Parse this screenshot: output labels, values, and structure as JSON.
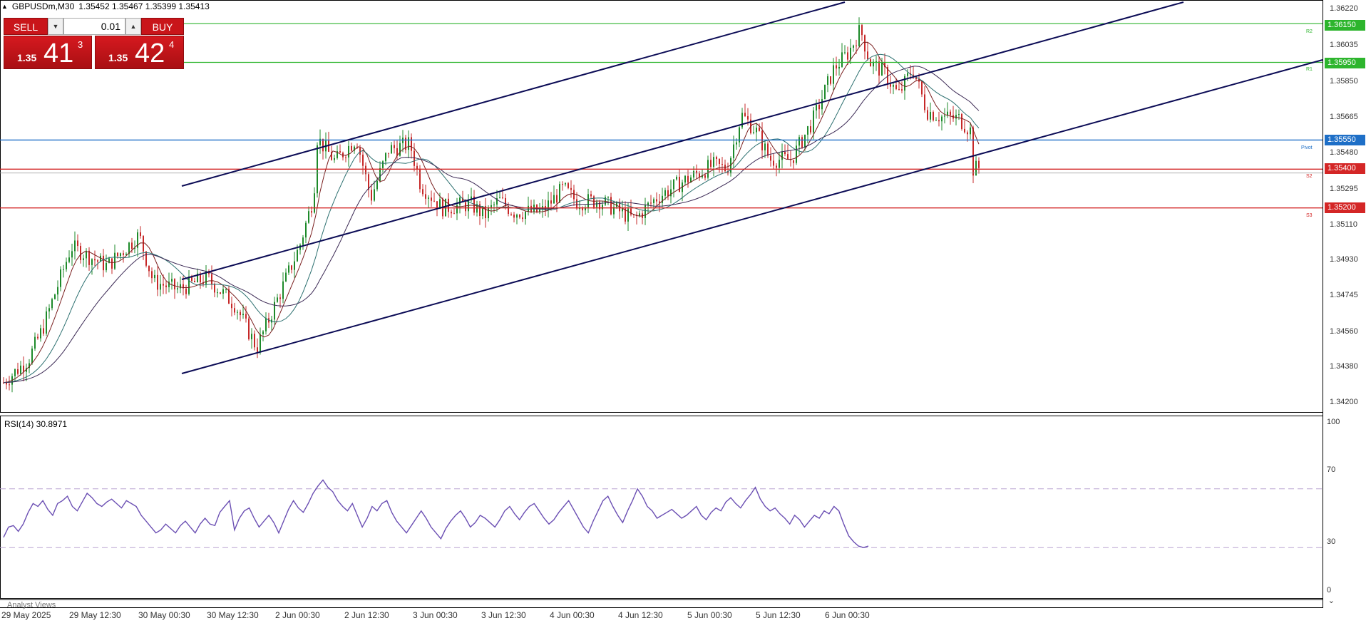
{
  "chart_header": {
    "collapse_icon": "triangle-up-icon",
    "symbol": "GBPUSDm,M30",
    "ohlc": "1.35452 1.35467 1.35399 1.35413"
  },
  "trade_panel": {
    "sell_label": "SELL",
    "buy_label": "BUY",
    "volume": "0.01",
    "down_icon": "chevron-down-icon",
    "up_icon": "chevron-up-icon",
    "bid": {
      "prefix": "1.35",
      "big": "41",
      "sup": "3"
    },
    "ask": {
      "prefix": "1.35",
      "big": "42",
      "sup": "4"
    }
  },
  "price_axis": [
    "1.36220",
    "1.36035",
    "1.35850",
    "1.35665",
    "1.35480",
    "1.35295",
    "1.35110",
    "1.34930",
    "1.34745",
    "1.34560",
    "1.34380",
    "1.34200"
  ],
  "levels": {
    "r2": {
      "price": "1.36150",
      "tag": "R2",
      "color": "#2db52d"
    },
    "r1": {
      "price": "1.35950",
      "tag": "R1",
      "color": "#2db52d"
    },
    "pivot": {
      "price": "1.35550",
      "tag": "Pivot",
      "color": "#1e6fc7"
    },
    "s2": {
      "price": "1.35400",
      "tag": "S2",
      "color": "#d42626"
    },
    "s3": {
      "price": "1.35200",
      "tag": "S3",
      "color": "#d42626"
    }
  },
  "rsi": {
    "label": "RSI(14) 30.8971",
    "axis": [
      "100",
      "70",
      "30",
      "0"
    ],
    "values": [
      37,
      44,
      45,
      41,
      46,
      54,
      60,
      58,
      62,
      56,
      52,
      60,
      62,
      65,
      58,
      55,
      61,
      67,
      64,
      60,
      58,
      61,
      63,
      60,
      57,
      62,
      60,
      58,
      52,
      48,
      44,
      40,
      42,
      46,
      43,
      40,
      45,
      48,
      44,
      40,
      46,
      50,
      46,
      45,
      54,
      58,
      62,
      42,
      50,
      55,
      57,
      50,
      44,
      48,
      52,
      47,
      40,
      48,
      56,
      62,
      57,
      54,
      60,
      67,
      72,
      76,
      71,
      68,
      62,
      58,
      55,
      60,
      52,
      44,
      50,
      58,
      55,
      60,
      62,
      54,
      48,
      44,
      40,
      45,
      50,
      55,
      50,
      44,
      40,
      36,
      43,
      48,
      52,
      55,
      50,
      44,
      47,
      52,
      50,
      47,
      44,
      49,
      55,
      58,
      53,
      49,
      54,
      58,
      60,
      55,
      50,
      46,
      49,
      54,
      58,
      62,
      56,
      50,
      44,
      40,
      48,
      55,
      62,
      65,
      58,
      52,
      47,
      55,
      62,
      70,
      65,
      58,
      55,
      50,
      52,
      54,
      56,
      53,
      50,
      52,
      55,
      58,
      52,
      49,
      54,
      57,
      55,
      61,
      64,
      60,
      57,
      62,
      66,
      71,
      63,
      58,
      55,
      57,
      53,
      50,
      46,
      52,
      49,
      44,
      48,
      52,
      50,
      55,
      53,
      58,
      55,
      46,
      38,
      34,
      31,
      30,
      31
    ]
  },
  "time_axis": [
    "29 May 2025",
    "29 May 12:30",
    "30 May 00:30",
    "30 May 12:30",
    "2 Jun 00:30",
    "2 Jun 12:30",
    "3 Jun 00:30",
    "3 Jun 12:30",
    "4 Jun 00:30",
    "4 Jun 12:30",
    "5 Jun 00:30",
    "5 Jun 12:30",
    "6 Jun 00:30"
  ],
  "bottom_tab": "Analyst Views",
  "scroll_icon": "chevron-down-icon"
}
